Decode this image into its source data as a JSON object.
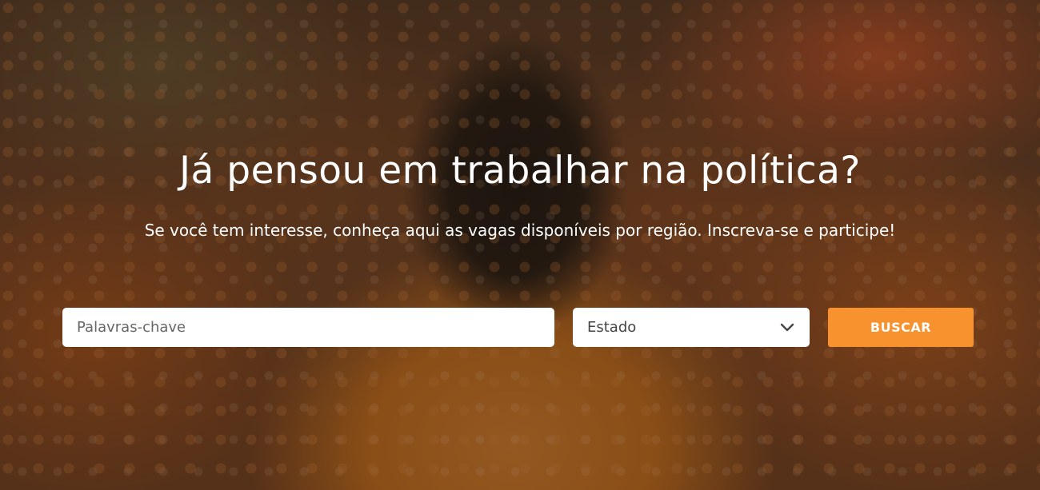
{
  "hero": {
    "headline": "Já pensou em trabalhar na política?",
    "subtitle": "Se você tem interesse, conheça aqui as vagas disponíveis por região. Inscreva-se e participe!",
    "background_image": "crowd-in-orange-shirts-photo"
  },
  "search": {
    "keywords_placeholder": "Palavras-chave",
    "keywords_value": "",
    "state_selected": "Estado",
    "state_icon": "chevron-down-icon",
    "button_label": "BUSCAR"
  },
  "colors": {
    "accent": "#f7922f",
    "text_on_hero": "#ffffff"
  }
}
